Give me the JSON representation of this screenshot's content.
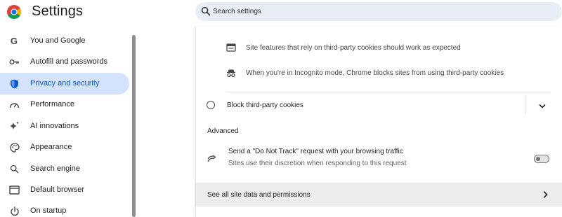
{
  "header": {
    "title": "Settings",
    "logo_icon": "chrome-logo",
    "search": {
      "placeholder": "Search settings",
      "value": ""
    }
  },
  "sidebar": {
    "items": [
      {
        "label": "You and Google",
        "icon": "google-g-icon"
      },
      {
        "label": "Autofill and passwords",
        "icon": "key-icon"
      },
      {
        "label": "Privacy and security",
        "icon": "shield-icon",
        "active": true
      },
      {
        "label": "Performance",
        "icon": "speedometer-icon"
      },
      {
        "label": "AI innovations",
        "icon": "sparkle-icon"
      },
      {
        "label": "Appearance",
        "icon": "palette-icon"
      },
      {
        "label": "Search engine",
        "icon": "search-icon"
      },
      {
        "label": "Default browser",
        "icon": "browser-window-icon"
      },
      {
        "label": "On startup",
        "icon": "power-icon"
      }
    ]
  },
  "main": {
    "info_rows": [
      {
        "text": "Site features that rely on third-party cookies should work as expected",
        "icon": "web-card-icon"
      },
      {
        "text": "When you're in Incognito mode, Chrome blocks sites from using third-party cookies",
        "icon": "incognito-icon"
      }
    ],
    "block_option": {
      "label": "Block third-party cookies",
      "selected": false
    },
    "advanced_heading": "Advanced",
    "do_not_track": {
      "title": "Send a \"Do Not Track\" request with your browsing traffic",
      "description": "Sites use their discretion when responding to this request",
      "enabled": false
    },
    "site_data_link": "See all site data and permissions"
  },
  "colors": {
    "accent": "#0b57d0",
    "active_bg": "#d3e3fd",
    "search_bg": "#e9eef6"
  }
}
